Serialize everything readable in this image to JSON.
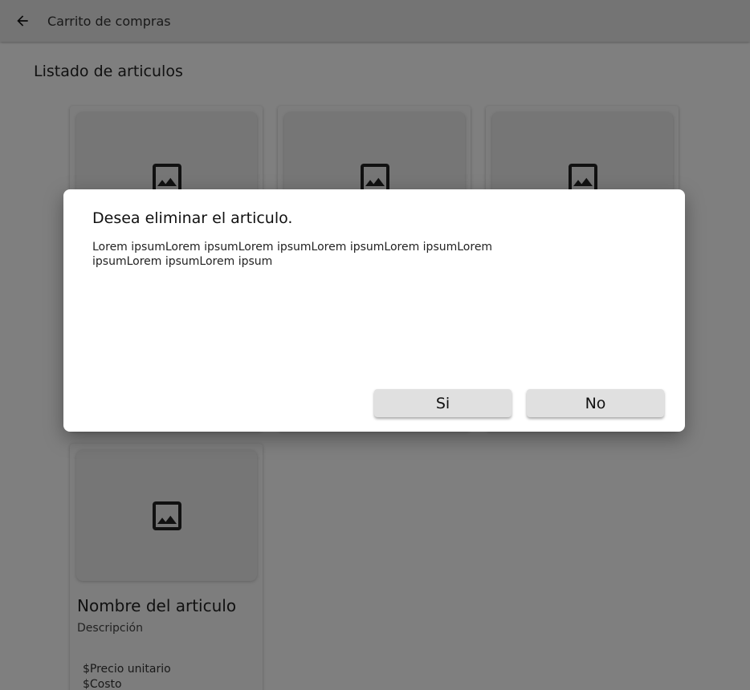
{
  "appbar": {
    "back_icon": "arrow-back-icon",
    "title": "Carrito de compras"
  },
  "main": {
    "section_title": "Listado de articulos",
    "cards": [
      {
        "image_icon": "image-placeholder-icon"
      },
      {
        "image_icon": "image-placeholder-icon"
      },
      {
        "image_icon": "image-placeholder-icon"
      },
      {
        "image_icon": "image-placeholder-icon",
        "name": "Nombre del articulo",
        "description": "Descripción",
        "price": "$Precio unitario",
        "cost": "$Costo"
      }
    ]
  },
  "dialog": {
    "title": "Desea eliminar el articulo.",
    "body": "Lorem ipsumLorem ipsumLorem ipsumLorem ipsumLorem ipsumLorem ipsumLorem ipsumLorem ipsum",
    "confirm_label": "Si",
    "cancel_label": "No"
  },
  "colors": {
    "scrim": "#000000",
    "button_bg": "#e0e0e0",
    "dialog_bg": "#ffffff"
  }
}
